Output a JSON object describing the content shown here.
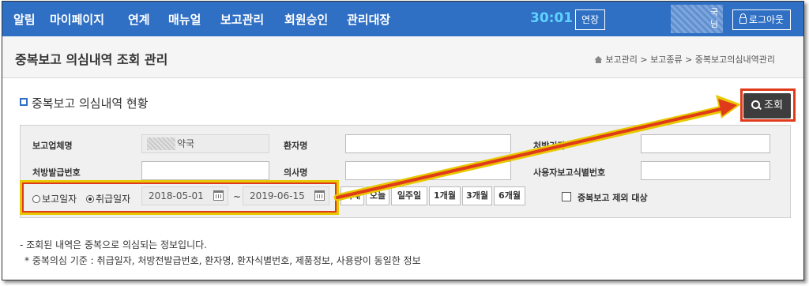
{
  "nav": {
    "items": [
      "알림",
      "마이페이지",
      "연계",
      "매뉴얼",
      "보고관리",
      "회원승인",
      "관리대장"
    ],
    "timer": "30:01",
    "extend_label": "연장",
    "user_text_1": "국",
    "user_text_2": "님",
    "logout_label": "로그아웃"
  },
  "header": {
    "title": "중복보고 의심내역 조회 관리",
    "breadcrumb": "보고관리 > 보고종류 > 중복보고의심내역관리"
  },
  "section": {
    "title": "중복보고 의심내역 현황",
    "search_label": "조회"
  },
  "form": {
    "reporter_label": "보고업체명",
    "reporter_value": "약국",
    "patient_label": "환자명",
    "prescriber_label": "처방기관",
    "prescription_label": "처방발급번호",
    "doctor_label": "의사명",
    "user_id_label": "사용자보고식별번호",
    "radio_report": "보고일자",
    "radio_handling": "취급일자",
    "date_from": "2018-05-01",
    "date_sep": "~",
    "date_to": "2019-06-15",
    "quick_buttons": [
      "어제",
      "오늘",
      "일주일",
      "1개월",
      "3개월",
      "6개월"
    ],
    "exclude_label": "중복보고 제외 대상"
  },
  "notes": {
    "line1": "- 조회된 내역은 중복으로 의심되는 정보입니다.",
    "line2": "* 중복의심 기준 : 취급일자, 처방전발급번호, 환자명, 환자식별번호, 제품정보, 사용량이 동일한 정보"
  },
  "colors": {
    "nav_bg": "#2f6fc4",
    "timer": "#5fd3ff",
    "highlight_red": "#e03a1a",
    "highlight_yellow": "#e8c800"
  }
}
